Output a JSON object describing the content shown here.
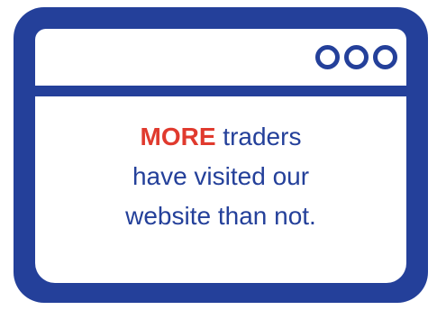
{
  "colors": {
    "frame": "#24409a",
    "text": "#24409a",
    "highlight": "#e03a2e",
    "background": "#ffffff"
  },
  "window": {
    "controls": [
      "circle-icon",
      "circle-icon",
      "circle-icon"
    ]
  },
  "message": {
    "highlight": "MORE",
    "line1_rest": " traders",
    "line2": "have visited our",
    "line3": "website than not."
  }
}
